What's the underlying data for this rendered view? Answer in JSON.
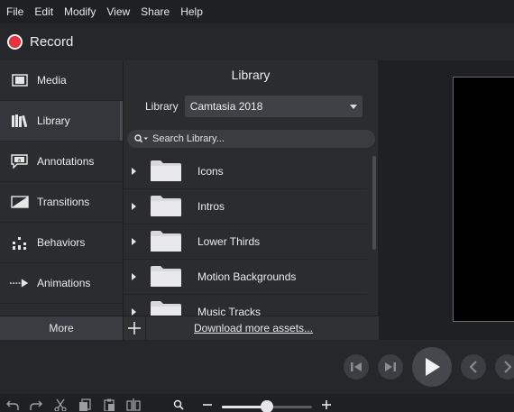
{
  "menubar": {
    "items": [
      "File",
      "Edit",
      "Modify",
      "View",
      "Share",
      "Help"
    ]
  },
  "record": {
    "label": "Record"
  },
  "sidebar": {
    "items": [
      {
        "label": "Media",
        "icon": "film-icon"
      },
      {
        "label": "Library",
        "icon": "books-icon",
        "active": true
      },
      {
        "label": "Annotations",
        "icon": "callout-icon"
      },
      {
        "label": "Transitions",
        "icon": "transition-icon"
      },
      {
        "label": "Behaviors",
        "icon": "behaviors-icon"
      },
      {
        "label": "Animations",
        "icon": "animation-arrow-icon"
      }
    ],
    "more_label": "More"
  },
  "library": {
    "title": "Library",
    "select_label": "Library",
    "selected": "Camtasia 2018",
    "search_placeholder": "Search Library...",
    "items": [
      {
        "name": "Icons"
      },
      {
        "name": "Intros"
      },
      {
        "name": "Lower Thirds"
      },
      {
        "name": "Motion Backgrounds"
      },
      {
        "name": "Music Tracks"
      }
    ],
    "download_link": "Download more assets..."
  },
  "player": {
    "zoom_fraction": 0.5
  },
  "colors": {
    "record_red": "#e8333a",
    "panel_bg": "#2a2c30",
    "app_bg": "#1e1f21"
  }
}
